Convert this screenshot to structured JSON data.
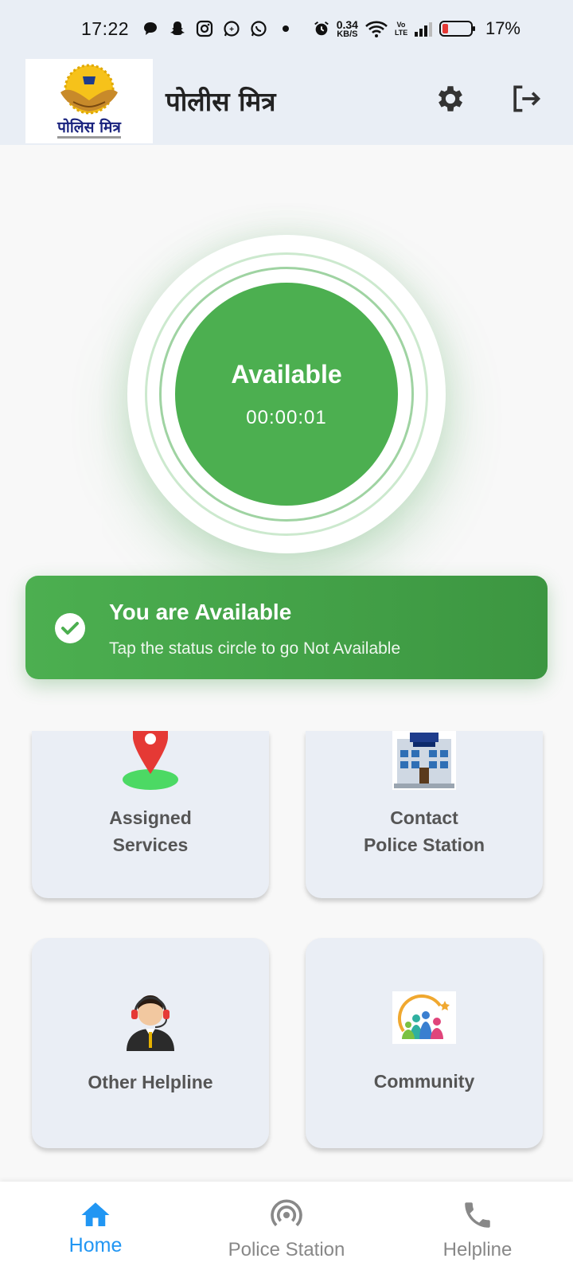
{
  "status_bar": {
    "time": "17:22",
    "net_speed_value": "0.34",
    "net_speed_unit": "KB/S",
    "volte_label": "Vo LTE",
    "battery_percent": "17%",
    "icons": [
      "chat-icon",
      "snapchat-icon",
      "instagram-icon",
      "whatsapp-business-icon",
      "whatsapp-icon",
      "dot-icon",
      "alarm-icon",
      "wifi-icon",
      "signal-icon",
      "battery-icon"
    ]
  },
  "header": {
    "app_title": "पोलीस मित्र",
    "logo_text": "पोलिस मित्र",
    "settings_icon": "gear-icon",
    "logout_icon": "logout-icon"
  },
  "status": {
    "label": "Available",
    "timer": "00:00:01",
    "color": "#4caf50"
  },
  "snackbar": {
    "title": "You are Available",
    "subtitle": "Tap the status circle to go Not Available"
  },
  "tiles": [
    {
      "label": "Assigned\nServices",
      "icon": "location-pin-icon"
    },
    {
      "label": "Contact\nPolice Station",
      "icon": "police-building-icon"
    },
    {
      "label": "Other Helpline",
      "icon": "helpline-agent-icon"
    },
    {
      "label": "Community",
      "icon": "community-icon"
    }
  ],
  "bottom_nav": {
    "items": [
      {
        "label": "Home",
        "icon": "home-icon",
        "active": true
      },
      {
        "label": "Police Station",
        "icon": "signal-tower-icon",
        "active": false
      },
      {
        "label": "Helpline",
        "icon": "phone-icon",
        "active": false
      }
    ],
    "active_color": "#2196f3"
  }
}
